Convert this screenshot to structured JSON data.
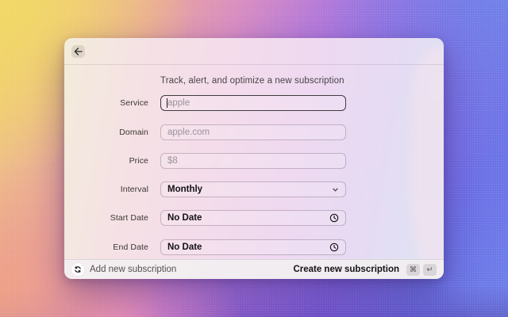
{
  "window": {
    "header": {
      "back_icon": "arrow-left"
    }
  },
  "form": {
    "title": "Track, alert, and optimize a new subscription",
    "fields": [
      {
        "label": "Service",
        "placeholder": "apple",
        "control": "text-input",
        "state": "focused"
      },
      {
        "label": "Domain",
        "placeholder": "apple.com",
        "control": "text-input"
      },
      {
        "label": "Price",
        "placeholder": "$8",
        "control": "text-input"
      },
      {
        "label": "Interval",
        "value": "Monthly",
        "control": "select",
        "icon": "chevron-down"
      },
      {
        "label": "Start Date",
        "value": "No Date",
        "control": "date-picker",
        "icon": "clock"
      },
      {
        "label": "End Date",
        "value": "No Date",
        "control": "date-picker",
        "icon": "clock"
      }
    ]
  },
  "footer": {
    "action_hint": "Add new subscription",
    "refresh_icon": "refresh-cycle",
    "submit_label": "Create new subscription",
    "shortcut_keys": [
      "⌘",
      "↵"
    ]
  },
  "colors": {
    "bg_yellow": "#f0d666",
    "bg_salmon": "#ed9f8b",
    "bg_pink": "#ef8fc4",
    "bg_purple": "#9a6cdf",
    "bg_blue": "#6d81e9",
    "window_tint_left": "#f3ecda",
    "window_tint_right": "#dfe4f6",
    "footer_bg": "#f2eff0",
    "text_dark": "#141214",
    "text_muted": "#55504f",
    "placeholder": "#9b929d",
    "focus_border": "#403c40"
  }
}
